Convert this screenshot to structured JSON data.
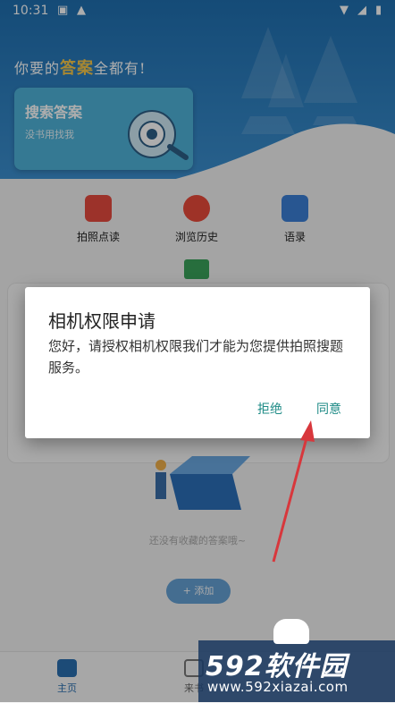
{
  "status_bar": {
    "time": "10:31"
  },
  "header": {
    "slogan_prefix": "你要的",
    "slogan_highlight": "答案",
    "slogan_suffix": "全都有!"
  },
  "search_card": {
    "title": "搜索答案",
    "subtitle": "没书用找我"
  },
  "menu": [
    {
      "label": "拍照点读",
      "icon": "camera-icon",
      "color": "#e64a3f"
    },
    {
      "label": "浏览历史",
      "icon": "history-icon",
      "color": "#e94a3a"
    },
    {
      "label": "语录",
      "icon": "quote-icon",
      "color": "#3b7fd6"
    }
  ],
  "content": {
    "empty_text": "还没有收藏的答案哦~",
    "add_button": "+ 添加"
  },
  "bottom_nav": {
    "home": "主页",
    "second": "来书"
  },
  "dialog": {
    "title": "相机权限申请",
    "message": "您好，请授权相机权限我们才能为您提供拍照搜题服务。",
    "deny": "拒绝",
    "allow": "同意"
  },
  "watermark": {
    "logo": "592软件园",
    "url": "www.592xiazai.com"
  },
  "colors": {
    "header_blue": "#1f6fb0",
    "accent_teal": "#1e8b86",
    "arrow_red": "#d8373c"
  }
}
